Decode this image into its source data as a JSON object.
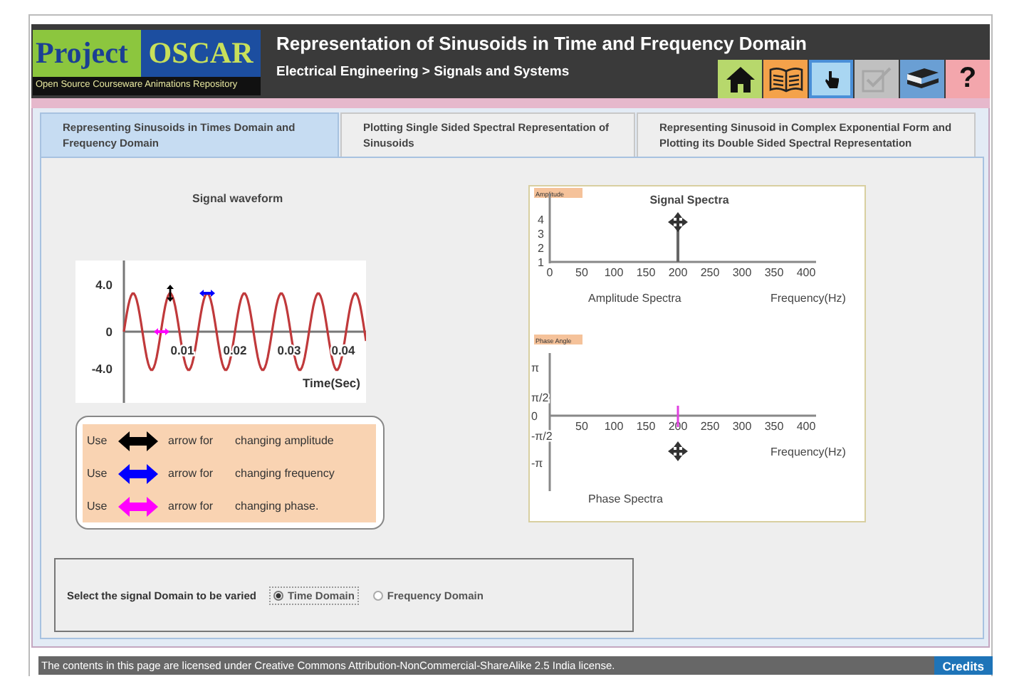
{
  "header": {
    "logo": {
      "project": "Project",
      "oscar": "OSCAR",
      "tagline": "Open Source Courseware Animations Repository"
    },
    "title": "Representation of Sinusoids in Time and Frequency Domain",
    "breadcrumb": "Electrical Engineering > Signals and Systems",
    "toolbar": [
      {
        "kind": "home",
        "selected": false,
        "disabled": false
      },
      {
        "kind": "book",
        "selected": false,
        "disabled": false
      },
      {
        "kind": "pointer",
        "selected": true,
        "disabled": false
      },
      {
        "kind": "check",
        "selected": false,
        "disabled": true
      },
      {
        "kind": "books",
        "selected": false,
        "disabled": false
      },
      {
        "kind": "help",
        "glyph": "?",
        "selected": false,
        "disabled": false
      }
    ]
  },
  "tabs": [
    {
      "label": "Representing Sinusoids in Times Domain and Frequency Domain",
      "selected": true
    },
    {
      "label": "Plotting Single Sided Spectral Representation of Sinusoids",
      "selected": false
    },
    {
      "label": "Representing Sinusoid in Complex Exponential Form and Plotting its Double Sided Spectral Representation",
      "selected": false
    }
  ],
  "waveform": {
    "title": "Signal waveform",
    "y_ticks": [
      "4.0",
      "0",
      "-4.0"
    ],
    "x_ticks": [
      "0.01",
      "0.02",
      "0.03",
      "0.04"
    ],
    "x_label": "Time(Sec)"
  },
  "legend": [
    {
      "use": "Use",
      "color": "#000000",
      "arrow_for": "arrow for",
      "action": "changing amplitude"
    },
    {
      "use": "Use",
      "color": "#0000ff",
      "arrow_for": "arrow for",
      "action": "changing frequency"
    },
    {
      "use": "Use",
      "color": "#ff00ff",
      "arrow_for": "arrow for",
      "action": "changing phase."
    }
  ],
  "spectra": {
    "title": "Signal Spectra",
    "amplitude": {
      "tag": "Amplitude",
      "y_ticks": [
        "4",
        "3",
        "2",
        "1"
      ],
      "x_ticks": [
        "0",
        "50",
        "100",
        "150",
        "200",
        "250",
        "300",
        "350",
        "400"
      ],
      "label": "Amplitude Spectra",
      "x_label": "Frequency(Hz)"
    },
    "phase": {
      "tag": "Phase Angle",
      "y_ticks": [
        "π",
        "π/2",
        "0",
        "-π/2",
        "-π"
      ],
      "x_ticks": [
        "50",
        "100",
        "150",
        "200",
        "250",
        "300",
        "350",
        "400"
      ],
      "label": "Phase Spectra",
      "x_label": "Frequency(Hz)"
    }
  },
  "domain": {
    "prompt": "Select the signal Domain to be varied",
    "options": [
      {
        "label": "Time Domain",
        "selected": true
      },
      {
        "label": "Frequency Domain",
        "selected": false
      }
    ]
  },
  "footer": {
    "license": "The contents in this page are licensed under Creative Commons Attribution-NonCommercial-ShareAlike 2.5 India license.",
    "credits": "Credits"
  }
}
